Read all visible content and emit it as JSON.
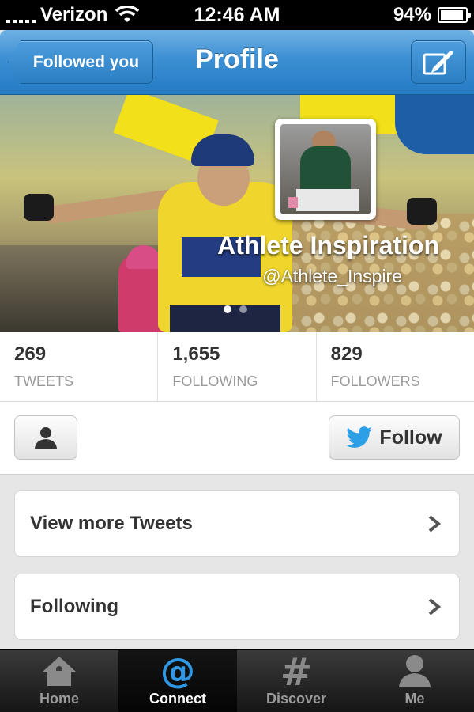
{
  "status_bar": {
    "carrier": "Verizon",
    "time": "12:46 AM",
    "battery": "94%",
    "battery_level": 0.94,
    "icons": [
      "signal-icon",
      "wifi-icon",
      "battery-icon"
    ]
  },
  "nav": {
    "back_label": "Followed you",
    "title": "Profile",
    "compose_icon": "compose-icon"
  },
  "profile": {
    "name": "Athlete Inspiration",
    "handle": "@Athlete_Inspire",
    "page_dots": 2,
    "page_active": 1
  },
  "stats": [
    {
      "value": "269",
      "label": "TWEETS"
    },
    {
      "value": "1,655",
      "label": "FOLLOWING"
    },
    {
      "value": "829",
      "label": "FOLLOWERS"
    }
  ],
  "actions": {
    "person_icon": "person-icon",
    "follow_label": "Follow",
    "follow_icon": "twitter-bird-icon"
  },
  "list": [
    {
      "label": "View more Tweets"
    },
    {
      "label": "Following"
    }
  ],
  "tabs": [
    {
      "label": "Home",
      "icon": "home-icon",
      "active": false
    },
    {
      "label": "Connect",
      "icon": "at-icon",
      "active": true
    },
    {
      "label": "Discover",
      "icon": "hash-icon",
      "active": false
    },
    {
      "label": "Me",
      "icon": "person-icon",
      "active": false
    }
  ],
  "colors": {
    "nav_blue": "#2a7ec2",
    "twitter_blue": "#1da1f2"
  }
}
